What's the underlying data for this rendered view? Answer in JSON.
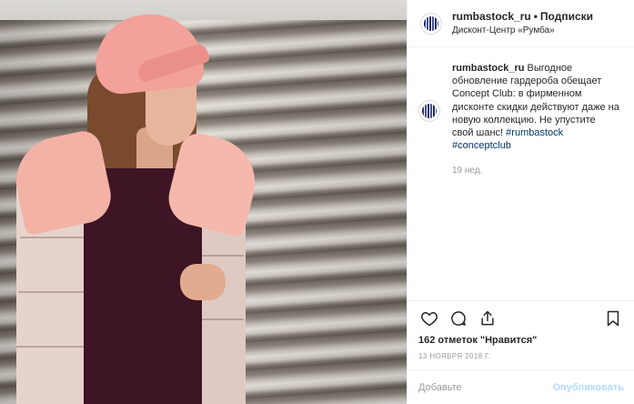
{
  "post": {
    "header": {
      "username": "rumbastock_ru",
      "separator": "•",
      "follow_label": "Подписки",
      "location": "Дисконт-Центр «Румба»",
      "avatar_icon": "rumba-logo-icon"
    },
    "caption": {
      "username": "rumbastock_ru",
      "text": " Выгодное обновление гардероба обещает Concept Club: в фирменном дисконте скидки действуют даже на новую коллекцию. Не упустите свой шанс! ",
      "hashtag1": "#rumbastock",
      "hashtag2": "#conceptclub",
      "time_ago": "19 нед."
    },
    "actions": {
      "like_icon": "heart-icon",
      "comment_icon": "comment-icon",
      "share_icon": "share-icon",
      "save_icon": "bookmark-icon"
    },
    "likes": "162 отметок \"Нравится\"",
    "date": "13 ноября 2018 г.",
    "comment": {
      "placeholder": "Добавьте комментарий...",
      "display_placeholder": "Добавьте",
      "value": "",
      "publish_label": "Опубликовать"
    },
    "colors": {
      "text": "#262626",
      "secondary": "#999999",
      "hashtag": "#003569",
      "publish_disabled": "#b3dbff",
      "border": "#efefef"
    }
  }
}
